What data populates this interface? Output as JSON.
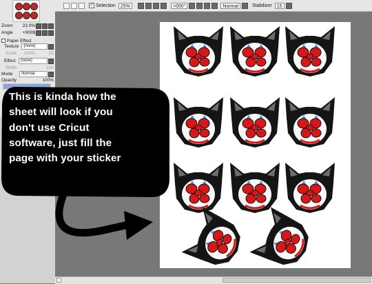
{
  "toolbar": {
    "selection_label": "Selection",
    "selection_value": "25%",
    "rotation_value": "+000°",
    "blend_mode": "Normal",
    "stabilizer_label": "Stabilizer",
    "stabilizer_value": "15"
  },
  "left_panel": {
    "zoom_label": "Zoom",
    "zoom_value": "23.0%",
    "angle_label": "Angle",
    "angle_value": "+000$",
    "paper_effect_label": "Paper Effect",
    "texture_label": "Texture",
    "texture_value": "(none)",
    "texture_scale_label": "Scale",
    "texture_scale_value": "100%",
    "texture_scale_extra": "20",
    "effect_label": "Effect",
    "effect_value": "(none)",
    "effect_width_label": "Width",
    "effect_width_value": "100",
    "mode_label": "Mode",
    "mode_value": "Normal",
    "opacity_label": "Opacity",
    "opacity_value": "100%",
    "opacity_level": 1.0
  },
  "overlay": {
    "bubble_text": "This is kinda how the\nsheet will look if you\ndon't use Cricut\nsoftware, just fill the\npage with your sticker"
  },
  "colors": {
    "bubble": "#000000",
    "sticker_red": "#d81818",
    "sticker_blue": "#4a8fe0"
  },
  "icons": {
    "arrow": "curved-arrow-right-icon",
    "sticker": "clown-cat-sticker"
  }
}
